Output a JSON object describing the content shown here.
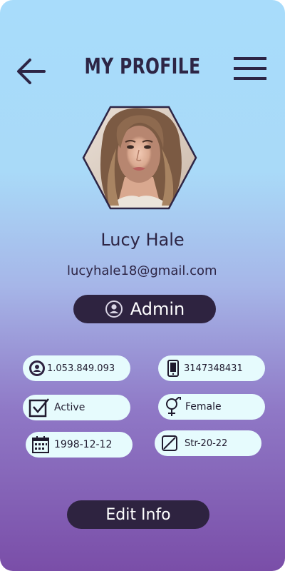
{
  "header": {
    "title": "MY PROFILE"
  },
  "profile": {
    "name": "Lucy Hale",
    "email": "lucyhale18@gmail.com",
    "role": "Admin"
  },
  "details": {
    "id_number": "1.053.849.093",
    "phone": "3147348431",
    "status": "Active",
    "gender": "Female",
    "birth_date": "1998-12-12",
    "address": "Str-20-22"
  },
  "actions": {
    "edit_label": "Edit Info"
  },
  "icons": {
    "back": "arrow-left-icon",
    "menu": "hamburger-menu-icon",
    "role": "user-circle-icon",
    "id": "id-card-user-icon",
    "phone": "phone-icon",
    "status": "checkbox-icon",
    "gender": "female-symbol-icon",
    "birth_date": "calendar-icon",
    "address": "map-icon"
  },
  "colors": {
    "accent_dark": "#2e2340",
    "chip_bg": "#e6fbfd",
    "text_dark": "#2d2545"
  }
}
